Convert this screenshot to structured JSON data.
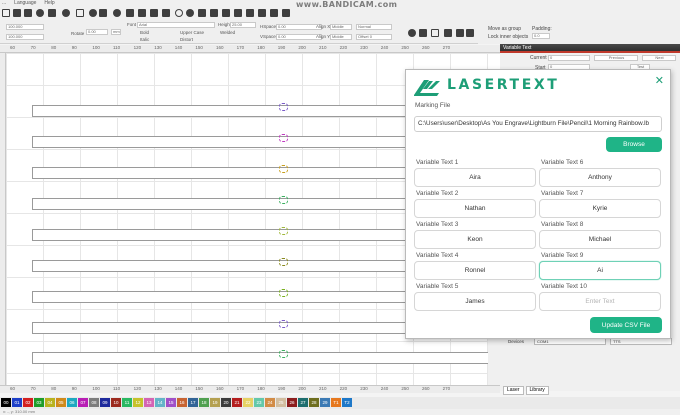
{
  "watermark": "www.BANDICAM.com",
  "menu": [
    "...",
    "Language",
    "Help"
  ],
  "toolbar2": {
    "x_value": "100.000",
    "y_value": "100.000",
    "rotate_label": "Rotate",
    "rotate_value": "0.00",
    "font_label": "Font",
    "font_value": "Arial",
    "height_label": "Height",
    "height_value": "25.00",
    "hspace_label": "HSpace",
    "hspace_value": "0.00",
    "vspace_label": "VSpace",
    "vspace_value": "0.00",
    "align_x_label": "Align X",
    "align_x_value": "Middle",
    "align_y_label": "Align Y",
    "align_y_value": "Middle",
    "normal_value": "Normal",
    "offset_value": "Offset 0",
    "bold_label": "Bold",
    "italic_label": "Italic",
    "upper_case_label": "Upper Case",
    "distort_label": "Distort",
    "welded_label": "Welded",
    "mm_label": "mm"
  },
  "right_top": {
    "move_as_group": "Move as group",
    "lock_inner": "Lock inner objects",
    "padding_label": "Padding:",
    "padding_value": "0.0"
  },
  "variable_text_panel": {
    "title": "Variable Text",
    "current_label": "Current",
    "current_value": "0",
    "start_label": "Start",
    "start_value": "0",
    "previous": "Previous",
    "next": "Next",
    "test": "Test"
  },
  "ruler_top": [
    "60",
    "70",
    "80",
    "90",
    "100",
    "110",
    "120",
    "130",
    "140",
    "150",
    "160",
    "170",
    "180",
    "190",
    "200",
    "210",
    "220",
    "230",
    "240",
    "250",
    "260",
    "270"
  ],
  "ruler_bottom": [
    "60",
    "70",
    "80",
    "90",
    "100",
    "110",
    "120",
    "130",
    "140",
    "150",
    "160",
    "170",
    "180",
    "190",
    "200",
    "210",
    "220",
    "230",
    "240",
    "250",
    "260",
    "270"
  ],
  "devices": {
    "label": "Devices",
    "port": "COM1",
    "type": "TTS"
  },
  "bottom_tabs": [
    "Laser",
    "Library"
  ],
  "palette": [
    {
      "label": "00",
      "color": "#000000"
    },
    {
      "label": "01",
      "color": "#1e40c8"
    },
    {
      "label": "02",
      "color": "#d42020"
    },
    {
      "label": "03",
      "color": "#1e9d2a"
    },
    {
      "label": "04",
      "color": "#b8b21e"
    },
    {
      "label": "05",
      "color": "#d08a1a"
    },
    {
      "label": "06",
      "color": "#1ea8c0"
    },
    {
      "label": "07",
      "color": "#b81eb4"
    },
    {
      "label": "08",
      "color": "#7d7d7d"
    },
    {
      "label": "09",
      "color": "#1e2a9c"
    },
    {
      "label": "10",
      "color": "#9c2a1e"
    },
    {
      "label": "11",
      "color": "#2ab862"
    },
    {
      "label": "12",
      "color": "#c6c22a"
    },
    {
      "label": "13",
      "color": "#d464b4"
    },
    {
      "label": "14",
      "color": "#64b4c8"
    },
    {
      "label": "15",
      "color": "#a050c8"
    },
    {
      "label": "16",
      "color": "#c86432"
    },
    {
      "label": "17",
      "color": "#326496"
    },
    {
      "label": "18",
      "color": "#50a050"
    },
    {
      "label": "19",
      "color": "#b4a050"
    },
    {
      "label": "20",
      "color": "#3c3c3c"
    },
    {
      "label": "21",
      "color": "#b41e1e"
    },
    {
      "label": "22",
      "color": "#e6d264"
    },
    {
      "label": "23",
      "color": "#64c8aa"
    },
    {
      "label": "24",
      "color": "#d28c46"
    },
    {
      "label": "25",
      "color": "#d2bea0"
    },
    {
      "label": "26",
      "color": "#8c1e1e"
    },
    {
      "label": "27",
      "color": "#1e6e6e"
    },
    {
      "label": "28",
      "color": "#6e6e1e"
    },
    {
      "label": "29",
      "color": "#3c7ab4"
    },
    {
      "label": "T1",
      "color": "#e6781e"
    },
    {
      "label": "T2",
      "color": "#1e78c8"
    }
  ],
  "status": "x: -, y: 310.00 mm",
  "dialog": {
    "logo": "LASERTEXT",
    "close": "✕",
    "marking_file_label": "Marking File",
    "marking_file_path": "C:\\Users\\user\\Desktop\\As You Engrave\\Lightburn File\\Pencil\\1 Morning Rainbow.lb",
    "browse": "Browse",
    "variables": [
      {
        "label": "Variable Text 1",
        "value": "Aira"
      },
      {
        "label": "Variable Text 6",
        "value": "Anthony"
      },
      {
        "label": "Variable Text 2",
        "value": "Nathan"
      },
      {
        "label": "Variable Text 7",
        "value": "Kyrie"
      },
      {
        "label": "Variable Text 3",
        "value": "Keon"
      },
      {
        "label": "Variable Text 8",
        "value": "Michael"
      },
      {
        "label": "Variable Text 4",
        "value": "Ronnel"
      },
      {
        "label": "Variable Text 9",
        "value": "Ai"
      },
      {
        "label": "Variable Text 5",
        "value": "James"
      },
      {
        "label": "Variable Text 10",
        "value": ""
      }
    ],
    "empty_placeholder": "Enter Text",
    "update_button": "Update CSV File"
  }
}
